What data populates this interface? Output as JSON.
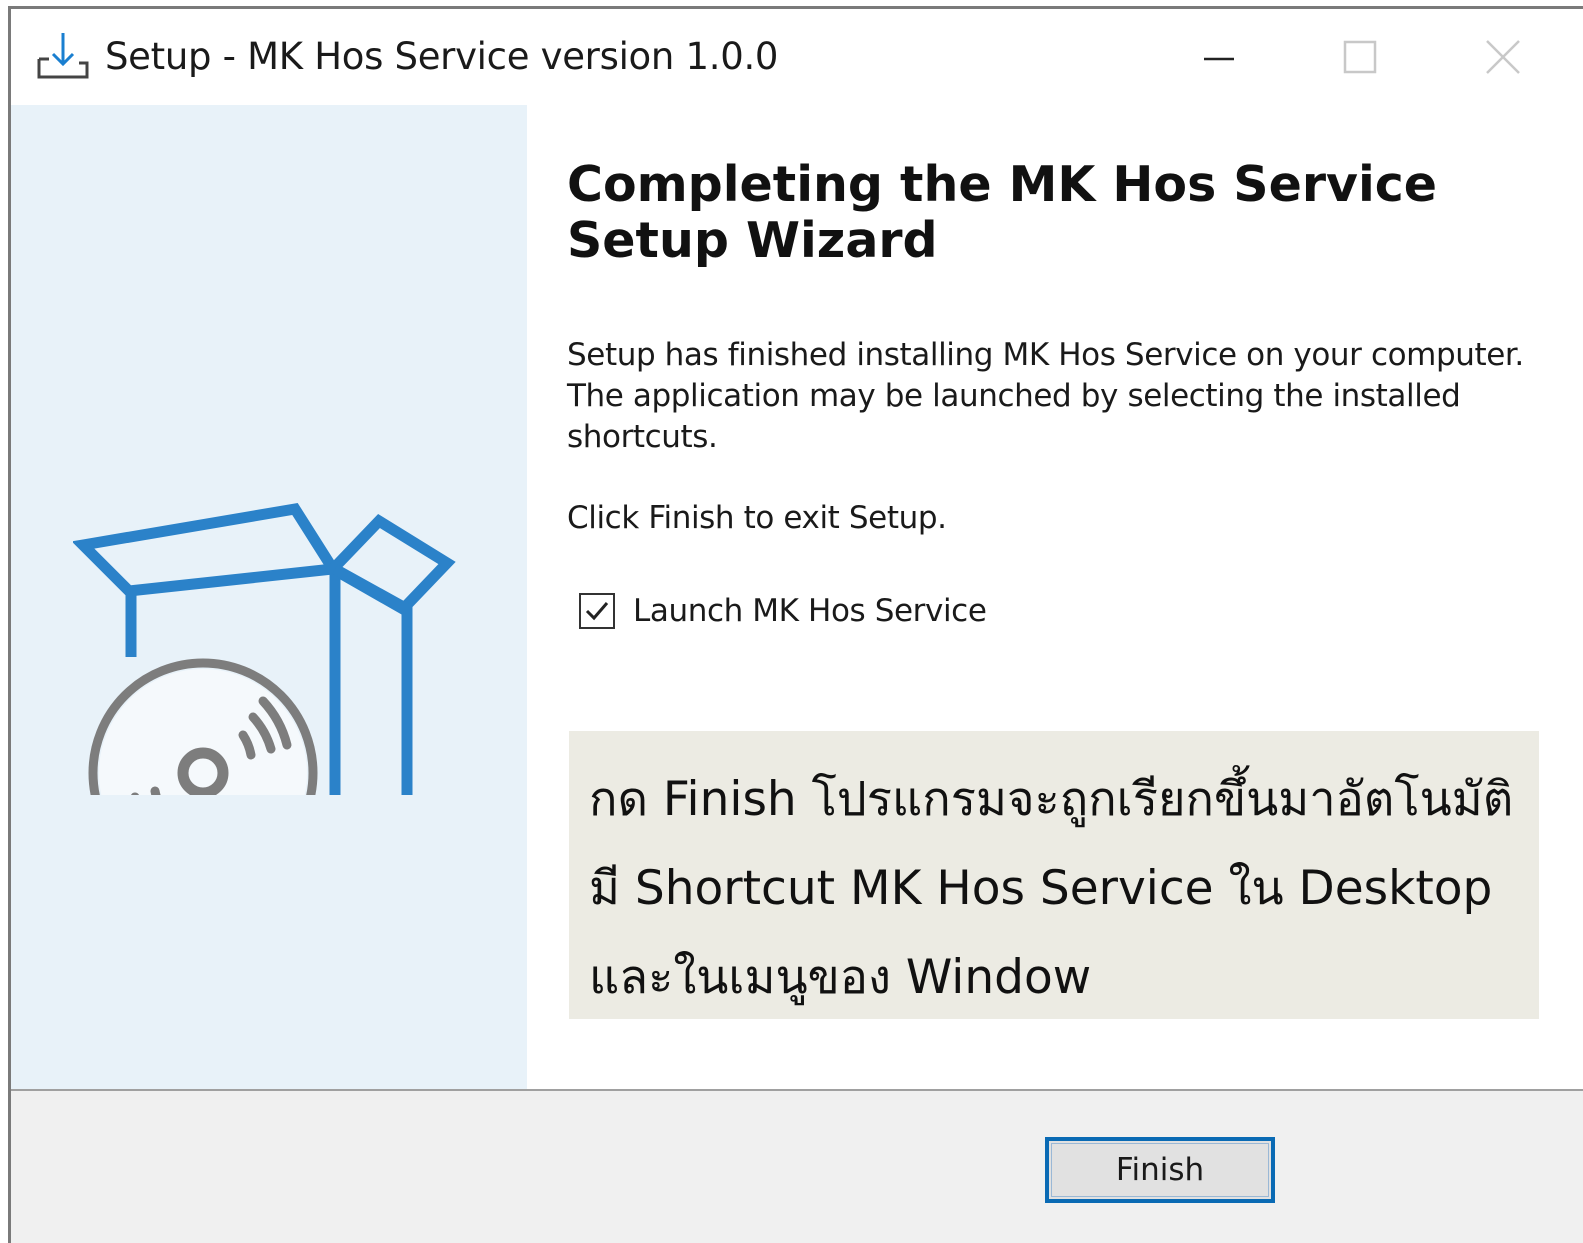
{
  "window": {
    "title": "Setup - MK Hos Service version 1.0.0",
    "controls": {
      "minimize_icon": "minimize-icon",
      "maximize_icon": "maximize-icon",
      "close_icon": "close-icon"
    }
  },
  "colors": {
    "left_panel": "#e8f2f9",
    "box_art": "#2b82c9",
    "disc_art": "#7d7d7d",
    "note_bg": "#ecebe3",
    "button_focus": "#0a6ab4",
    "footer": "#f0f0f0"
  },
  "wizard": {
    "heading_line1": "Completing the MK Hos Service",
    "heading_line2": "Setup Wizard",
    "body_line1": "Setup has finished installing MK Hos Service on your computer.",
    "body_line2": "The application may be launched by selecting the installed",
    "body_line3": "shortcuts.",
    "exit_text": "Click Finish to exit Setup.",
    "launch_checkbox": {
      "label": "Launch MK Hos Service",
      "checked": true
    }
  },
  "note": {
    "line1": "กด Finish โปรแกรมจะถูกเรียกขึ้นมาอัตโนมัติ",
    "line2": "มี Shortcut MK Hos Service ใน Desktop",
    "line3": "และในเมนูของ Window"
  },
  "footer": {
    "finish_label": "Finish"
  }
}
